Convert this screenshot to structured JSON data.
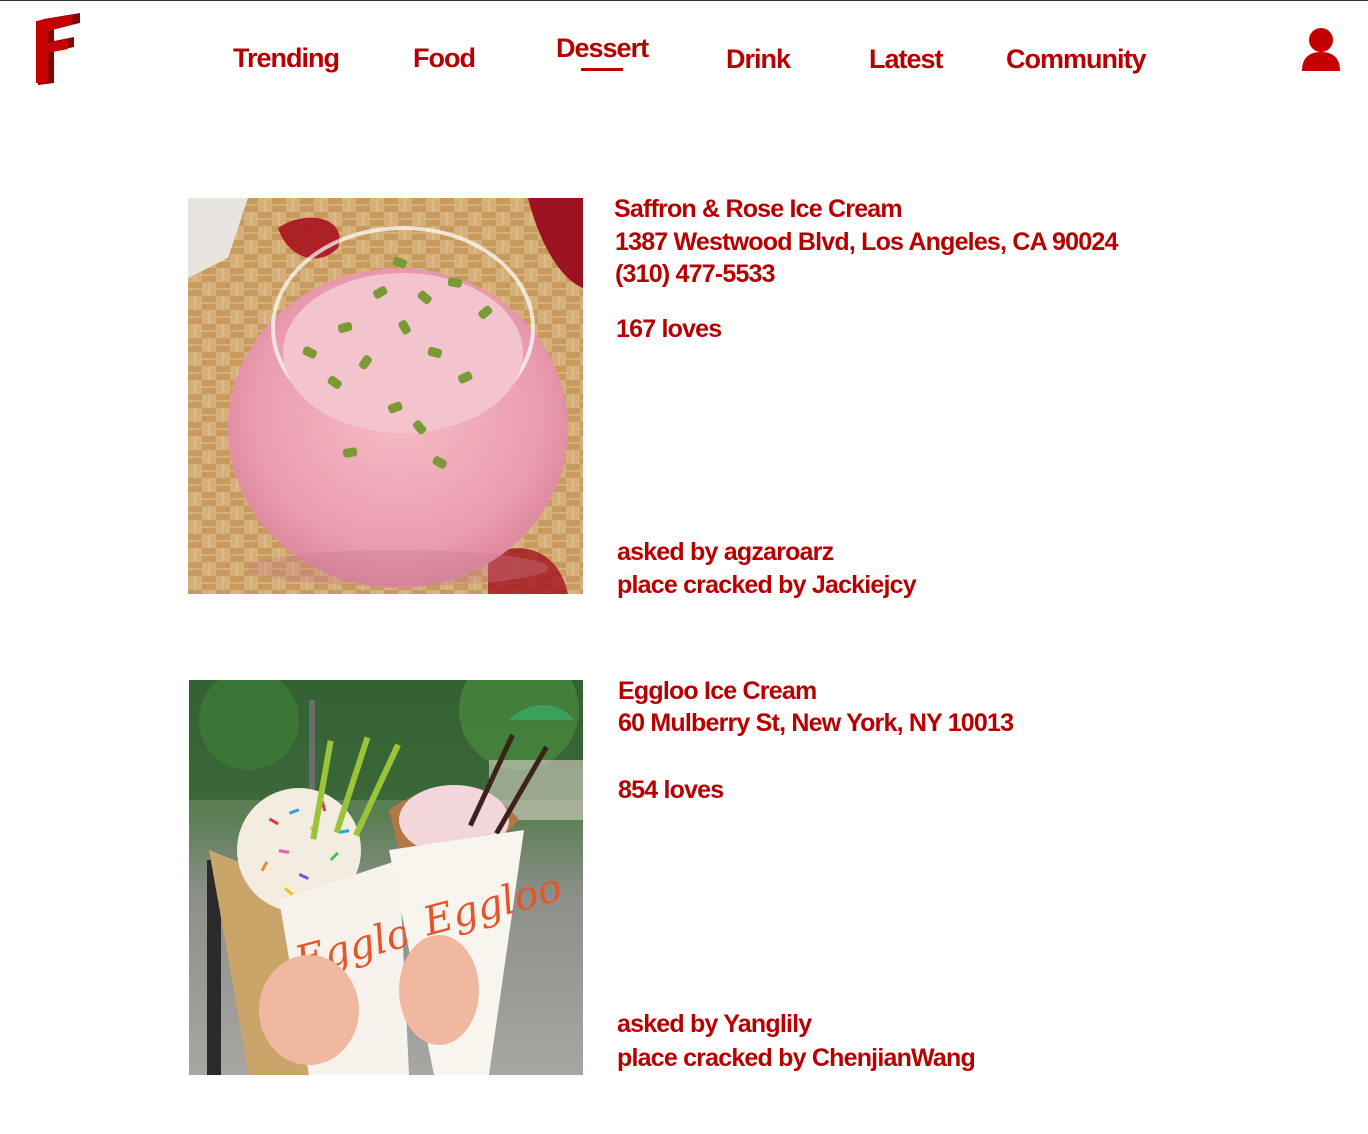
{
  "header": {
    "logo_letter": "F",
    "nav": [
      {
        "label": "Trending",
        "active": false
      },
      {
        "label": "Food",
        "active": false
      },
      {
        "label": "Dessert",
        "active": true
      },
      {
        "label": "Drink",
        "active": false
      },
      {
        "label": "Latest",
        "active": false
      },
      {
        "label": "Community",
        "active": false
      }
    ],
    "user_icon": "user-icon"
  },
  "theme": {
    "accent": "#b80000"
  },
  "posts": [
    {
      "name": "Saffron & Rose Ice Cream",
      "address": "1387 Westwood Blvd, Los Angeles, CA 90024",
      "phone": "(310) 477-5533",
      "loves": "167 loves",
      "asked_by_prefix": "asked by",
      "asked_by": "agzaroarz",
      "cracked_by_prefix": "place cracked by",
      "cracked_by": "Jackiejcy"
    },
    {
      "name": "Eggloo Ice Cream",
      "address": "60 Mulberry St, New York, NY 10013",
      "phone": "",
      "loves": "854 loves",
      "asked_by_prefix": "asked by",
      "asked_by": "Yanglily",
      "cracked_by_prefix": "place cracked by",
      "cracked_by": "ChenjianWang"
    }
  ]
}
